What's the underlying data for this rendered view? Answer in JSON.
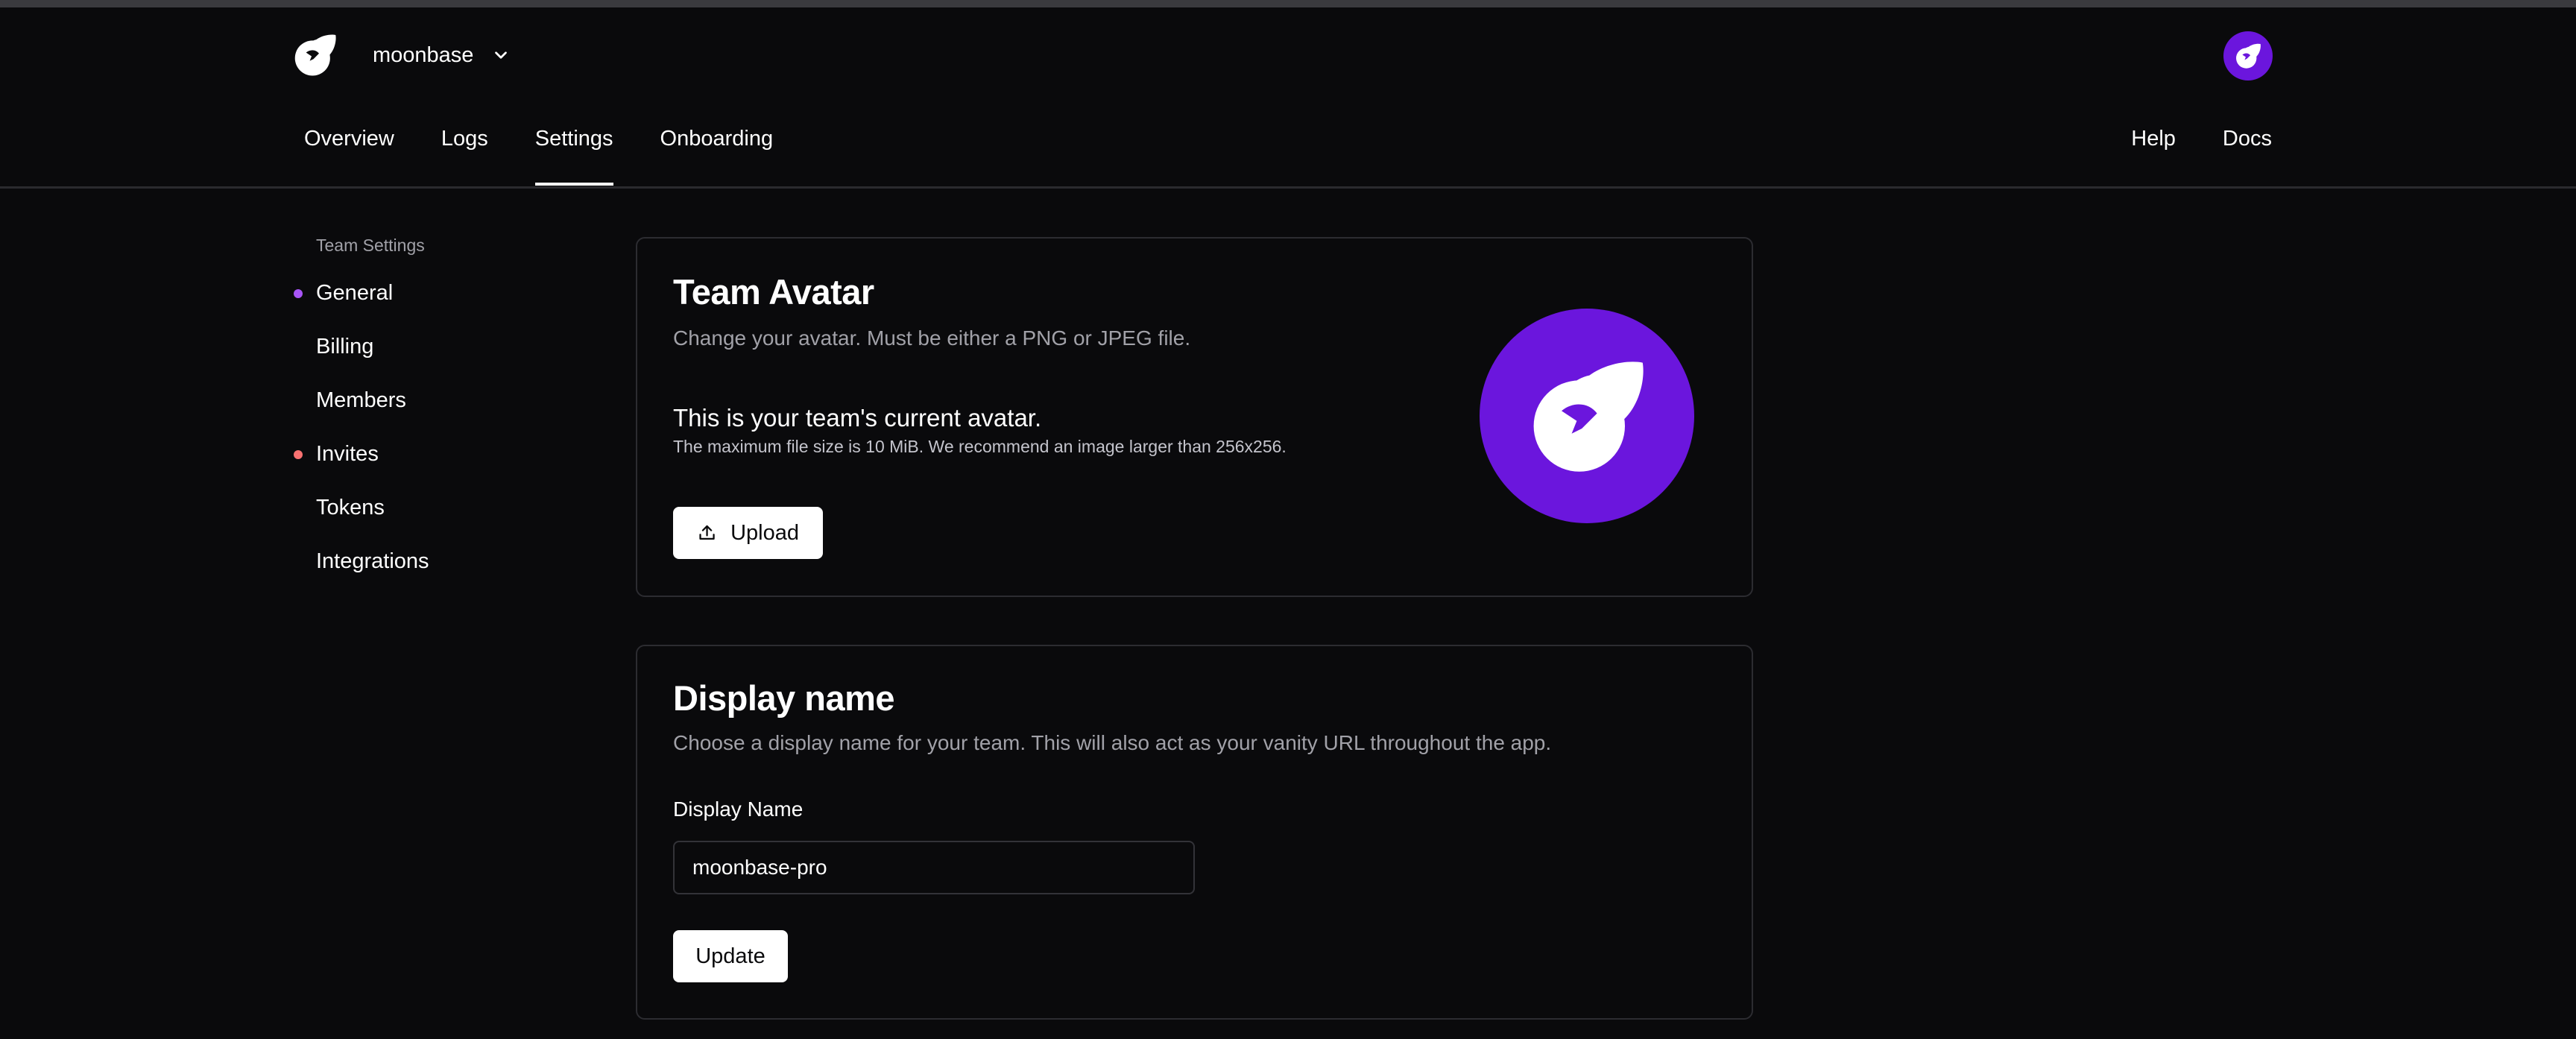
{
  "header": {
    "team_name": "moonbase",
    "nav": [
      "Overview",
      "Logs",
      "Settings",
      "Onboarding"
    ],
    "active_nav": "Settings",
    "nav_right": [
      "Help",
      "Docs"
    ]
  },
  "sidebar": {
    "title": "Team Settings",
    "items": [
      {
        "label": "General",
        "dot": "#a855f7"
      },
      {
        "label": "Billing"
      },
      {
        "label": "Members"
      },
      {
        "label": "Invites",
        "dot": "#f87171"
      },
      {
        "label": "Tokens"
      },
      {
        "label": "Integrations"
      }
    ]
  },
  "avatar_card": {
    "title": "Team Avatar",
    "subtitle": "Change your avatar. Must be either a PNG or JPEG file.",
    "current": "This is your team's current avatar.",
    "limit": "The maximum file size is 10 MiB. We recommend an image larger than 256x256.",
    "upload_label": "Upload"
  },
  "display_card": {
    "title": "Display name",
    "subtitle": "Choose a display name for your team. This will also act as your vanity URL throughout the app.",
    "field_label": "Display Name",
    "field_value": "moonbase-pro",
    "update_label": "Update"
  },
  "colors": {
    "accent": "#6b16dd",
    "background": "#0a0a0c"
  }
}
